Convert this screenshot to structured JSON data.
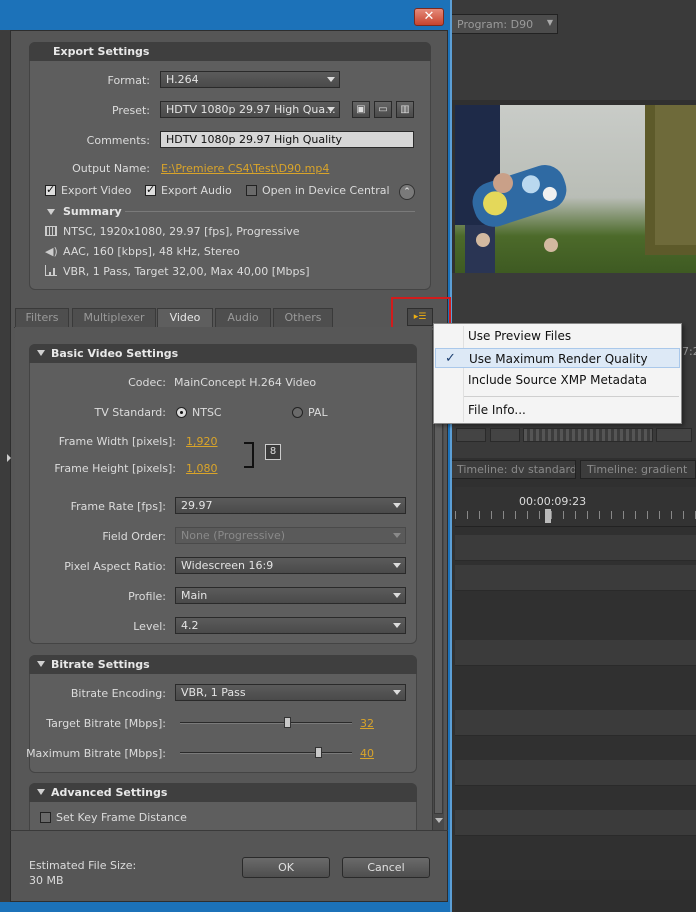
{
  "background": {
    "program_tab": "Program: D90",
    "timecode": "00:00:09:23",
    "timeline_tabs": [
      "Timeline: dv standard",
      "Timeline: gradient"
    ],
    "right_edge_text": "7:2"
  },
  "dialog": {
    "close_label": "✕",
    "export_settings": {
      "title": "Export Settings",
      "format_label": "Format:",
      "format_value": "H.264",
      "preset_label": "Preset:",
      "preset_value": "HDTV 1080p 29.97 High Qua...",
      "comments_label": "Comments:",
      "comments_value": "HDTV 1080p 29.97 High Quality",
      "output_name_label": "Output Name:",
      "output_name_value": "E:\\Premiere CS4\\Test\\D90.mp4",
      "export_video_label": "Export Video",
      "export_audio_label": "Export Audio",
      "device_central_label": "Open in Device Central",
      "export_video_checked": true,
      "export_audio_checked": true,
      "device_central_checked": false,
      "summary_title": "Summary",
      "summary_video": "NTSC, 1920x1080, 29.97 [fps], Progressive",
      "summary_audio": "AAC, 160 [kbps], 48 kHz, Stereo",
      "summary_bitrate": "VBR, 1 Pass, Target 32,00, Max 40,00 [Mbps]"
    },
    "tabs": [
      "Filters",
      "Multiplexer",
      "Video",
      "Audio",
      "Others"
    ],
    "active_tab": "Video",
    "basic_video": {
      "title": "Basic Video Settings",
      "codec_label": "Codec:",
      "codec_value": "MainConcept H.264 Video",
      "tv_standard_label": "TV Standard:",
      "ntsc_label": "NTSC",
      "pal_label": "PAL",
      "frame_width_label": "Frame Width [pixels]:",
      "frame_width_value": "1,920",
      "frame_height_label": "Frame Height [pixels]:",
      "frame_height_value": "1,080",
      "frame_rate_label": "Frame Rate [fps]:",
      "frame_rate_value": "29.97",
      "field_order_label": "Field Order:",
      "field_order_value": "None (Progressive)",
      "par_label": "Pixel Aspect Ratio:",
      "par_value": "Widescreen 16:9",
      "profile_label": "Profile:",
      "profile_value": "Main",
      "level_label": "Level:",
      "level_value": "4.2"
    },
    "bitrate": {
      "title": "Bitrate Settings",
      "encoding_label": "Bitrate Encoding:",
      "encoding_value": "VBR, 1 Pass",
      "target_label": "Target Bitrate [Mbps]:",
      "target_value": "32",
      "target_level": 0.62,
      "max_label": "Maximum Bitrate [Mbps]:",
      "max_value": "40",
      "max_level": 0.8
    },
    "advanced": {
      "title": "Advanced Settings",
      "keyframe_label": "Set Key Frame Distance"
    },
    "footer": {
      "estimated_label": "Estimated File Size:",
      "estimated_value": "30 MB",
      "ok_label": "OK",
      "cancel_label": "Cancel"
    }
  },
  "popup_menu": {
    "items": [
      "Use Preview Files",
      "Use Maximum Render Quality",
      "Include Source XMP Metadata",
      "File Info..."
    ],
    "checked_item": "Use Maximum Render Quality",
    "check_glyph": "✓"
  },
  "colors": {
    "accent_link": "#d9a42a",
    "highlight_box": "#d21c1c",
    "menu_highlight": "#dde9f6"
  }
}
